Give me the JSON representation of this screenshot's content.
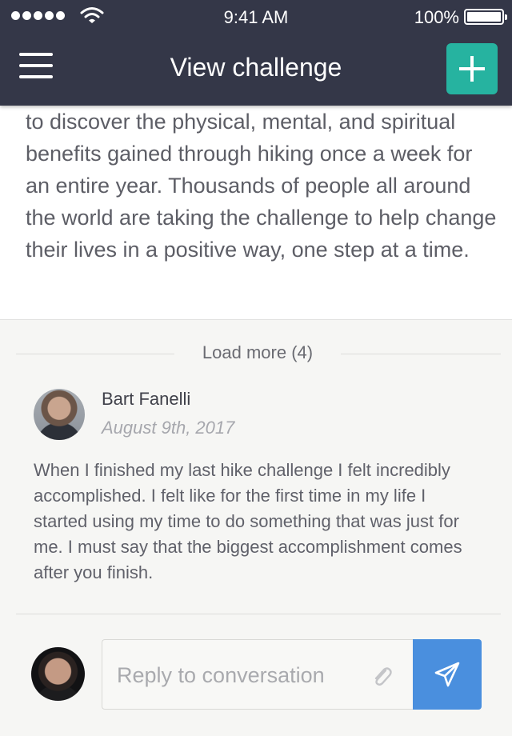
{
  "status_bar": {
    "time": "9:41 AM",
    "battery": "100%"
  },
  "header": {
    "title": "View challenge"
  },
  "description": {
    "text": "to discover the physical, mental, and spiritual benefits gained through hiking once a week for an entire year. Thousands of people all around the world are taking the challenge to help change their lives in a positive way, one step at a time."
  },
  "load_more": {
    "label": "Load more (4)"
  },
  "comment": {
    "author": "Bart Fanelli",
    "date": "August 9th, 2017",
    "text": "When I finished my last hike challenge I felt incredibly accomplished. I felt like for the first time in my life I started using my time to do something that was just for me. I must say that the biggest accomplishment comes after you finish."
  },
  "reply": {
    "placeholder": "Reply to conversation"
  },
  "colors": {
    "header_bg": "#343748",
    "accent_add": "#26b3a0",
    "send_bg": "#4a8fde"
  },
  "icons": [
    "signal-icon",
    "wifi-icon",
    "battery-icon",
    "menu-icon",
    "plus-icon",
    "paperclip-icon",
    "send-icon"
  ]
}
